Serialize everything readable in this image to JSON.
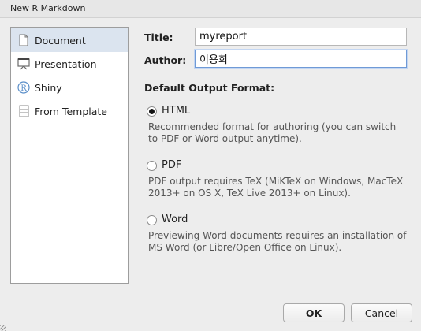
{
  "window": {
    "title": "New R Markdown"
  },
  "sidebar": {
    "items": [
      {
        "label": "Document",
        "icon": "document-icon",
        "active": true
      },
      {
        "label": "Presentation",
        "icon": "presentation-icon",
        "active": false
      },
      {
        "label": "Shiny",
        "icon": "shiny-icon",
        "active": false
      },
      {
        "label": "From Template",
        "icon": "template-icon",
        "active": false
      }
    ]
  },
  "form": {
    "title_label": "Title:",
    "title_value": "myreport",
    "author_label": "Author:",
    "author_value": "이용희"
  },
  "output": {
    "heading": "Default Output Format:",
    "options": [
      {
        "label": "HTML",
        "checked": true,
        "description": "Recommended format for authoring (you can switch to PDF or Word output anytime)."
      },
      {
        "label": "PDF",
        "checked": false,
        "description": "PDF output requires TeX (MiKTeX on Windows, MacTeX 2013+ on OS X, TeX Live 2013+ on Linux)."
      },
      {
        "label": "Word",
        "checked": false,
        "description": "Previewing Word documents requires an installation of MS Word (or Libre/Open Office on Linux)."
      }
    ]
  },
  "buttons": {
    "ok": "OK",
    "cancel": "Cancel"
  },
  "colors": {
    "active_item": "#dbe4ef",
    "focus_border": "#6f9ad6",
    "shiny_blue": "#5b8fc9"
  }
}
